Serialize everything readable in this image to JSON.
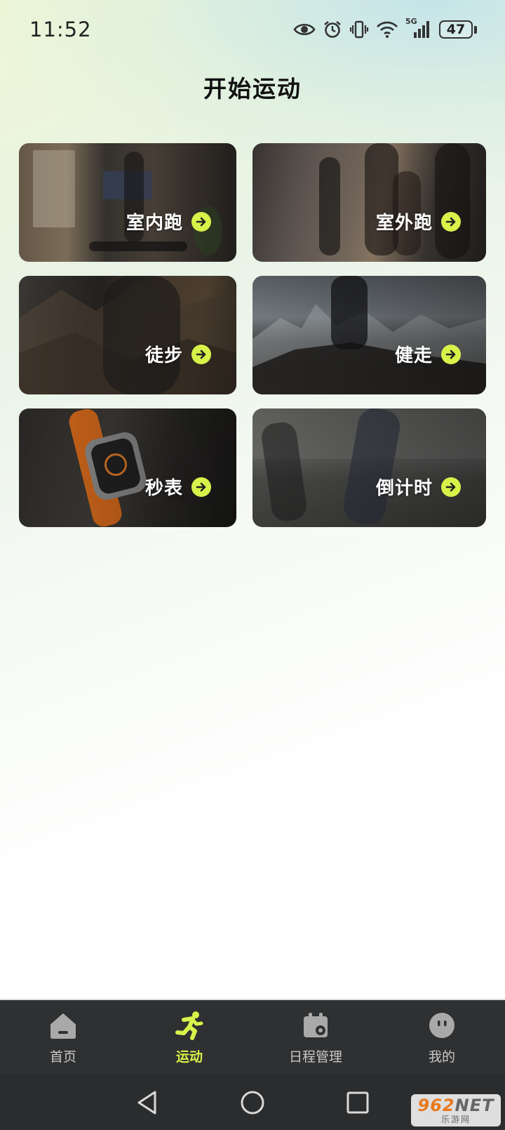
{
  "status_bar": {
    "time": "11:52",
    "network": "5G",
    "battery": "47"
  },
  "page": {
    "title": "开始运动"
  },
  "cards": [
    {
      "label": "室内跑",
      "icon": "arrow-right-icon"
    },
    {
      "label": "室外跑",
      "icon": "arrow-right-icon"
    },
    {
      "label": "徒步",
      "icon": "arrow-right-icon"
    },
    {
      "label": "健走",
      "icon": "arrow-right-icon"
    },
    {
      "label": "秒表",
      "icon": "arrow-right-icon"
    },
    {
      "label": "倒计时",
      "icon": "arrow-right-icon"
    }
  ],
  "bottom_nav": {
    "items": [
      {
        "label": "首页",
        "icon": "home-icon",
        "active": false
      },
      {
        "label": "运动",
        "icon": "running-icon",
        "active": true
      },
      {
        "label": "日程管理",
        "icon": "calendar-icon",
        "active": false
      },
      {
        "label": "我的",
        "icon": "profile-face-icon",
        "active": false
      }
    ]
  },
  "watermark": {
    "main": "962",
    "main_suffix": "NET",
    "sub": "乐游网"
  },
  "colors": {
    "accent": "#d8f24a",
    "nav_bg": "#2f3031",
    "nav_inactive": "#c9c9c9"
  }
}
